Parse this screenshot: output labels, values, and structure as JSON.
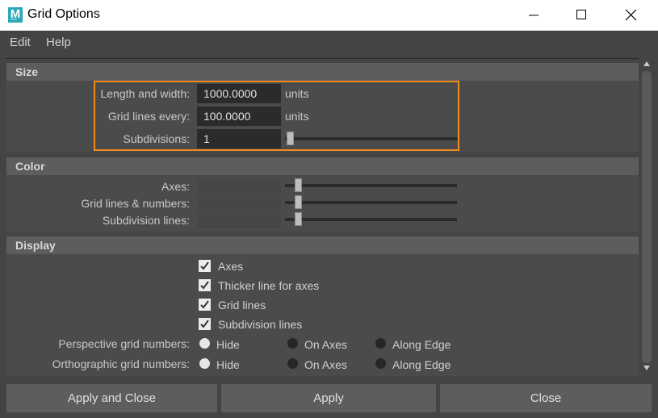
{
  "window": {
    "title": "Grid Options",
    "app_icon_letter": "M",
    "app_icon_sub": "MAYA"
  },
  "menu": {
    "edit": "Edit",
    "help": "Help"
  },
  "size": {
    "header": "Size",
    "length_label": "Length and width:",
    "length_value": "1000.0000",
    "length_unit": "units",
    "gridlines_label": "Grid lines every:",
    "gridlines_value": "100.0000",
    "gridlines_unit": "units",
    "subdiv_label": "Subdivisions:",
    "subdiv_value": "1"
  },
  "color": {
    "header": "Color",
    "axes_label": "Axes:",
    "gridlines_label": "Grid lines & numbers:",
    "subdiv_label": "Subdivision lines:"
  },
  "display": {
    "header": "Display",
    "checks": {
      "axes": "Axes",
      "thicker": "Thicker line for axes",
      "gridlines": "Grid lines",
      "subdiv": "Subdivision lines"
    },
    "perspective_label": "Perspective grid numbers:",
    "orthographic_label": "Orthographic grid numbers:",
    "radio_hide": "Hide",
    "radio_on_axes": "On Axes",
    "radio_along_edge": "Along Edge"
  },
  "buttons": {
    "apply_close": "Apply and Close",
    "apply": "Apply",
    "close": "Close"
  },
  "colors": {
    "highlight": "#f08c1e",
    "panel": "#444444",
    "header": "#5d5d5d"
  }
}
